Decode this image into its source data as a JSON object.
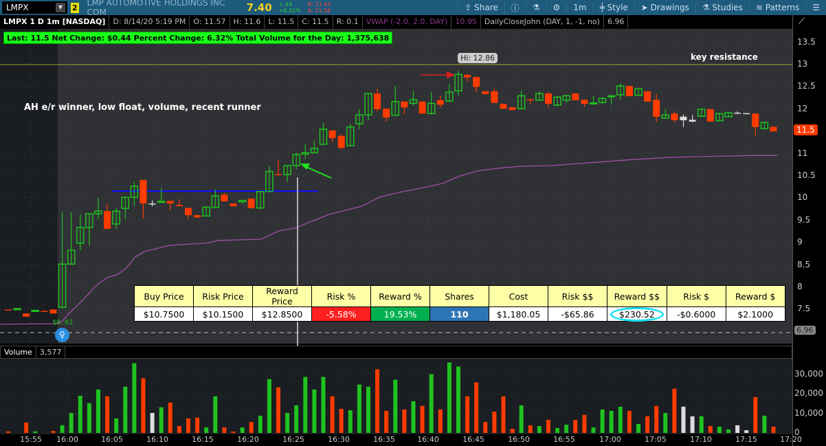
{
  "header": {
    "symbol": "LMPX",
    "link_group": "2",
    "company": "LMP AUTOMOTIVE HOLDINGS INC COM",
    "last": "7.40",
    "net_change": "+.44",
    "pct_change": "+6.32%",
    "bid": "B: 11.45",
    "ask": "A: 11.56",
    "tools": [
      "Share",
      "ⓘ",
      "⚗",
      "⚙",
      "1m",
      "Style",
      "Drawings",
      "Studies",
      "Patterns"
    ]
  },
  "info": {
    "title": "LMPX 1 D 1m [NASDAQ]",
    "date": "D: 8/14/20 5:19 PM",
    "open": "O: 11.57",
    "high": "H: 11.6",
    "low": "L: 11.5",
    "close": "C: 11.5",
    "range": "R: 0.1",
    "vwap": "VWAP (-2.0, 2.0, DAY)",
    "vwap_val": "10.95",
    "study": "DailyCloseJohn (DAY, 1, -1, no)",
    "study_val": "6.96"
  },
  "banner": "Last: 11.5  Net Change:  $0.44  Percent Change: 6.32%  Total Volume for the Day:  1,375,638",
  "annotations": {
    "thesis": "AH e/r winner, low float, volume, recent runner",
    "resistance": "key resistance",
    "hi_bubble": "Hi: 12.86",
    "pm_change": "$0.02"
  },
  "price_axis": {
    "labels": [
      "13.5",
      "13",
      "12.5",
      "12",
      "11",
      "10.5",
      "10",
      "9.5",
      "9",
      "8.5",
      "8",
      "7.5"
    ],
    "current": "11.5",
    "close_marker": "6.96"
  },
  "table": {
    "headers": [
      "Buy Price",
      "Risk Price",
      "Reward Price",
      "Risk %",
      "Reward %",
      "Shares",
      "Cost",
      "Risk $$",
      "Reward $$",
      "Risk $",
      "Reward $"
    ],
    "values": [
      "$10.7500",
      "$10.1500",
      "$12.8500",
      "-5.58%",
      "19.53%",
      "110",
      "$1,180.05",
      "-$65.86",
      "$230.52",
      "-$0.6000",
      "$2.1000"
    ],
    "colors": {
      "risk": "#ff2020",
      "reward": "#00b050",
      "shares": "#2e75b6",
      "highlight": "#20e0f0"
    }
  },
  "volume": {
    "label": "Volume",
    "value": "3,577",
    "axis": [
      "30,000",
      "20,000",
      "10,000",
      "0"
    ]
  },
  "time_axis": [
    "15:55",
    "16:00",
    "16:05",
    "16:10",
    "16:15",
    "16:20",
    "16:25",
    "16:30",
    "16:35",
    "16:40",
    "16:45",
    "16:50",
    "16:55",
    "17:00",
    "17:05",
    "17:10",
    "17:15",
    "17:20"
  ],
  "chart_data": {
    "type": "candlestick",
    "ylim": [
      6.73,
      13.8
    ],
    "resistance": 13.0,
    "support_line": 10.16,
    "colors": {
      "up": "#1fc21f",
      "down": "#ff3c00",
      "neutral": "#dddddd",
      "vwap": "#a050a8"
    },
    "candles": [
      [
        7.5,
        7.5,
        7.5,
        7.49,
        "r"
      ],
      [
        7.52,
        7.52,
        7.52,
        7.52,
        "g"
      ],
      [
        7.41,
        7.42,
        7.34,
        7.34,
        "r"
      ],
      [
        7.46,
        7.48,
        7.46,
        7.48,
        "g"
      ],
      [
        7.47,
        7.47,
        7.46,
        7.46,
        "r"
      ],
      [
        7.5,
        7.5,
        7.41,
        7.41,
        "r"
      ],
      [
        7.55,
        9.68,
        7.55,
        8.52,
        "g"
      ],
      [
        8.52,
        9.68,
        8.52,
        8.83,
        "g"
      ],
      [
        8.99,
        9.64,
        8.83,
        9.34,
        "g"
      ],
      [
        9.34,
        9.65,
        8.93,
        9.65,
        "g"
      ],
      [
        9.65,
        10.0,
        9.53,
        9.71,
        "g"
      ],
      [
        9.71,
        9.87,
        9.31,
        9.31,
        "r"
      ],
      [
        9.42,
        9.78,
        9.31,
        9.71,
        "g"
      ],
      [
        9.77,
        10.02,
        9.54,
        10.02,
        "g"
      ],
      [
        10.02,
        10.36,
        9.82,
        10.27,
        "g"
      ],
      [
        10.41,
        10.41,
        9.54,
        9.88,
        "r"
      ],
      [
        9.88,
        9.95,
        9.82,
        9.88,
        "w"
      ],
      [
        9.92,
        10.22,
        9.92,
        9.93,
        "g"
      ],
      [
        9.94,
        9.94,
        9.73,
        9.88,
        "r"
      ],
      [
        9.85,
        9.97,
        9.82,
        9.82,
        "r"
      ],
      [
        9.78,
        9.78,
        9.53,
        9.62,
        "r"
      ],
      [
        9.62,
        9.62,
        9.56,
        9.57,
        "r"
      ],
      [
        9.6,
        9.82,
        9.6,
        9.8,
        "g"
      ],
      [
        9.79,
        10.2,
        9.79,
        10.05,
        "g"
      ],
      [
        10.08,
        10.12,
        9.93,
        9.93,
        "r"
      ],
      [
        9.88,
        9.88,
        9.82,
        9.82,
        "r"
      ],
      [
        9.92,
        9.97,
        9.88,
        9.95,
        "g"
      ],
      [
        9.99,
        9.99,
        9.76,
        9.78,
        "r"
      ],
      [
        9.78,
        10.15,
        9.76,
        10.15,
        "g"
      ],
      [
        10.15,
        10.72,
        10.15,
        10.6,
        "g"
      ],
      [
        10.54,
        10.87,
        10.53,
        10.53,
        "r"
      ],
      [
        10.53,
        10.73,
        10.36,
        10.73,
        "g"
      ],
      [
        10.73,
        11.02,
        10.65,
        10.98,
        "g"
      ],
      [
        10.99,
        11.22,
        10.88,
        11.02,
        "g"
      ],
      [
        11.02,
        11.29,
        11.02,
        11.12,
        "g"
      ],
      [
        11.21,
        11.69,
        11.21,
        11.55,
        "g"
      ],
      [
        11.52,
        11.52,
        11.26,
        11.35,
        "r"
      ],
      [
        11.4,
        11.43,
        11.1,
        11.13,
        "r"
      ],
      [
        11.18,
        11.67,
        11.18,
        11.6,
        "g"
      ],
      [
        11.67,
        12.0,
        11.55,
        11.87,
        "g"
      ],
      [
        11.87,
        12.35,
        11.75,
        12.35,
        "g"
      ],
      [
        12.35,
        12.46,
        11.95,
        12.0,
        "r"
      ],
      [
        12.01,
        12.01,
        11.72,
        11.81,
        "r"
      ],
      [
        11.86,
        12.52,
        11.86,
        12.17,
        "g"
      ],
      [
        12.17,
        12.17,
        11.89,
        12.04,
        "r"
      ],
      [
        12.13,
        12.41,
        12.08,
        12.21,
        "g"
      ],
      [
        12.17,
        12.17,
        11.9,
        11.9,
        "r"
      ],
      [
        11.9,
        12.38,
        11.88,
        12.13,
        "g"
      ],
      [
        12.2,
        12.3,
        12.03,
        12.1,
        "r"
      ],
      [
        12.18,
        12.57,
        12.18,
        12.38,
        "g"
      ],
      [
        12.41,
        12.86,
        12.3,
        12.78,
        "g"
      ],
      [
        12.77,
        12.79,
        12.62,
        12.71,
        "r"
      ],
      [
        12.72,
        12.73,
        12.38,
        12.5,
        "r"
      ],
      [
        12.4,
        12.4,
        12.33,
        12.34,
        "r"
      ],
      [
        12.4,
        12.47,
        12.14,
        12.14,
        "r"
      ],
      [
        12.12,
        12.12,
        12.0,
        12.01,
        "r"
      ],
      [
        12.04,
        12.04,
        11.98,
        11.98,
        "r"
      ],
      [
        12.01,
        12.42,
        12.01,
        12.3,
        "g"
      ],
      [
        12.22,
        12.22,
        12.1,
        12.22,
        "r"
      ],
      [
        12.2,
        12.4,
        12.2,
        12.35,
        "g"
      ],
      [
        12.35,
        12.38,
        12.04,
        12.12,
        "r"
      ],
      [
        12.09,
        12.29,
        12.07,
        12.27,
        "g"
      ],
      [
        12.2,
        12.33,
        12.14,
        12.3,
        "g"
      ],
      [
        12.35,
        12.35,
        12.2,
        12.2,
        "r"
      ],
      [
        12.21,
        12.21,
        12.05,
        12.12,
        "r"
      ],
      [
        12.12,
        12.3,
        12.1,
        12.14,
        "g"
      ],
      [
        12.15,
        12.27,
        12.12,
        12.24,
        "g"
      ],
      [
        12.3,
        12.3,
        12.1,
        12.3,
        "g"
      ],
      [
        12.32,
        12.58,
        12.22,
        12.52,
        "g"
      ],
      [
        12.52,
        12.52,
        12.29,
        12.29,
        "r"
      ],
      [
        12.31,
        12.46,
        12.31,
        12.46,
        "g"
      ],
      [
        12.4,
        12.4,
        12.17,
        12.17,
        "r"
      ],
      [
        12.21,
        12.34,
        11.72,
        11.83,
        "r"
      ],
      [
        11.8,
        12.0,
        11.8,
        11.87,
        "g"
      ],
      [
        11.9,
        11.95,
        11.7,
        11.75,
        "r"
      ],
      [
        11.83,
        11.88,
        11.6,
        11.75,
        "w"
      ],
      [
        11.72,
        11.87,
        11.7,
        11.76,
        "w"
      ],
      [
        11.84,
        12.0,
        11.84,
        12.0,
        "g"
      ],
      [
        12.0,
        12.0,
        11.72,
        11.72,
        "r"
      ],
      [
        11.74,
        11.92,
        11.74,
        11.9,
        "g"
      ],
      [
        11.83,
        11.92,
        11.83,
        11.92,
        "g"
      ],
      [
        11.92,
        11.95,
        11.89,
        11.92,
        "w"
      ],
      [
        11.91,
        11.91,
        11.91,
        11.91,
        "w"
      ],
      [
        11.9,
        11.9,
        11.41,
        11.6,
        "r"
      ],
      [
        11.56,
        11.72,
        11.54,
        11.7,
        "g"
      ],
      [
        11.6,
        11.62,
        11.5,
        11.5,
        "r"
      ]
    ],
    "volumes": [
      800,
      0,
      5300,
      800,
      0,
      1000,
      3900,
      10200,
      19000,
      15200,
      22200,
      18700,
      7400,
      23600,
      35600,
      27900,
      10200,
      13100,
      15500,
      3500,
      7400,
      7800,
      2800,
      18700,
      2800,
      700,
      2800,
      5600,
      8800,
      27500,
      23300,
      10200,
      14100,
      28600,
      22200,
      28600,
      18700,
      12300,
      11600,
      24700,
      23600,
      32500,
      11300,
      27200,
      12000,
      16200,
      13800,
      30000,
      12000,
      36000,
      33900,
      18700,
      25800,
      5600,
      10900,
      18700,
      2100,
      14100,
      3900,
      3500,
      6700,
      2500,
      4200,
      6700,
      9200,
      2800,
      12000,
      11300,
      13400,
      11300,
      4600,
      8500,
      13800,
      10200,
      22600,
      13400,
      8500,
      8500,
      3500,
      3200,
      1800,
      3900,
      1400,
      18300,
      8800,
      3200
    ],
    "vwap": [
      [
        -0.9,
        7.17
      ],
      [
        5.4,
        7.18
      ],
      [
        6,
        7.24
      ],
      [
        6.7,
        7.4
      ],
      [
        8,
        7.66
      ],
      [
        10,
        8.08
      ],
      [
        11.1,
        8.23
      ],
      [
        12.1,
        8.28
      ],
      [
        13.1,
        8.43
      ],
      [
        14.1,
        8.68
      ],
      [
        15.1,
        8.8
      ],
      [
        16.1,
        8.85
      ],
      [
        17.9,
        8.94
      ],
      [
        20.2,
        8.97
      ],
      [
        22,
        8.99
      ],
      [
        23.3,
        9.05
      ],
      [
        28.1,
        9.08
      ],
      [
        30.1,
        9.27
      ],
      [
        31.9,
        9.33
      ],
      [
        33.2,
        9.44
      ],
      [
        34.7,
        9.56
      ],
      [
        35.7,
        9.64
      ],
      [
        39.3,
        9.82
      ],
      [
        41.2,
        10.02
      ],
      [
        43.4,
        10.13
      ],
      [
        46.2,
        10.24
      ],
      [
        48.2,
        10.33
      ],
      [
        50.2,
        10.5
      ],
      [
        52.3,
        10.62
      ],
      [
        55.3,
        10.69
      ],
      [
        57.3,
        10.72
      ],
      [
        60.2,
        10.73
      ],
      [
        68.8,
        10.86
      ],
      [
        73.9,
        10.92
      ],
      [
        83,
        10.96
      ],
      [
        85.5,
        10.96
      ]
    ]
  }
}
